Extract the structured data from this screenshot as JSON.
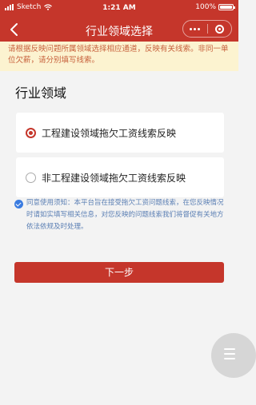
{
  "status_bar": {
    "carrier": "Sketch",
    "time": "1:21 AM",
    "battery": "100%"
  },
  "nav": {
    "title": "行业领域选择"
  },
  "notice": "请根据反映问题所属领域选择相应通道，反映有关线索。非同一单位欠薪，请分别填写线索。",
  "section_title": "行业领域",
  "options": [
    {
      "label": "工程建设领域拖欠工资线索反映",
      "selected": true
    },
    {
      "label": "非工程建设领域拖欠工资线索反映",
      "selected": false
    }
  ],
  "agreement": {
    "checked": true,
    "text": "同意使用须知：本平台旨在接受拖欠工资问题线索，在您反映情况时请如实填写相关信息，对您反映的问题线索我们将督促有关地方依法依规及时处理。"
  },
  "next_button": "下一步",
  "colors": {
    "primary": "#c5362b",
    "notice_bg": "#fcf3d0",
    "notice_text": "#c7613c",
    "agree_text": "#5b7fb4",
    "check": "#3a7be0"
  }
}
